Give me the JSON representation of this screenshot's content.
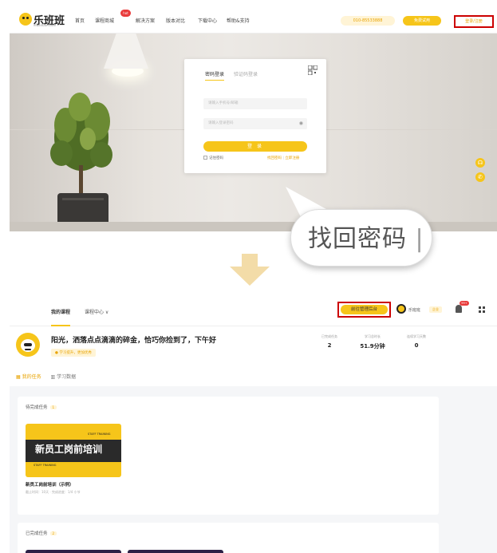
{
  "top": {
    "logo_text": "乐班班",
    "logo_sub": "leban­ban.com",
    "nav_items": [
      "首页",
      "课程商城",
      "解决方案",
      "版本对比",
      "下载中心",
      "帮助&支持"
    ],
    "hot_badge": "hot",
    "phone": "010-85533888",
    "trial_label": "免费试用",
    "login_register": "登录/注册",
    "login_card": {
      "tab_account": "密码登录",
      "tab_code": "验证码登录",
      "phone_placeholder": "请输入手机号/邮箱",
      "password_placeholder": "请输入登录密码",
      "login_button": "登 录",
      "remember": "记住密码",
      "forgot": "找回密码",
      "register": "立即注册"
    },
    "magnified_text": "找回密码"
  },
  "bottom": {
    "nav_items": [
      "我的课程",
      "课程中心"
    ],
    "admin_button": "前往管理后台",
    "org_name": "乐班班",
    "org_tag": "企业",
    "bell_count": "99+",
    "greeting": "阳光，洒落点点滴滴的碎金，恰巧你捡到了，下午好",
    "motto": "学习提升，更加优秀",
    "stats": [
      {
        "label": "已完成任务",
        "value": "2"
      },
      {
        "label": "学习总时长",
        "value": "51.9分钟"
      },
      {
        "label": "连续学习天数",
        "value": "0"
      }
    ],
    "tabs": [
      "我的任务",
      "学习数据"
    ],
    "pending_title": "待完成任务",
    "pending_count": "1",
    "course": {
      "cover_title": "新员工岗前培训",
      "cover_en": "STAFF TRAINING",
      "name": "新员工岗前培训（示例）",
      "meta": "截止时间：10天  ·  完成进度：1/4 小节"
    },
    "completed_title": "已完成任务",
    "completed_count": "2"
  },
  "colors": {
    "accent": "#f6c51a",
    "highlight_border": "#cc0000",
    "accent_text": "#e8a300"
  },
  "icons": [
    "qr-code-icon",
    "eye-icon",
    "headset-icon",
    "phone-icon",
    "down-arrow-icon",
    "bell-icon",
    "grid-icon"
  ]
}
